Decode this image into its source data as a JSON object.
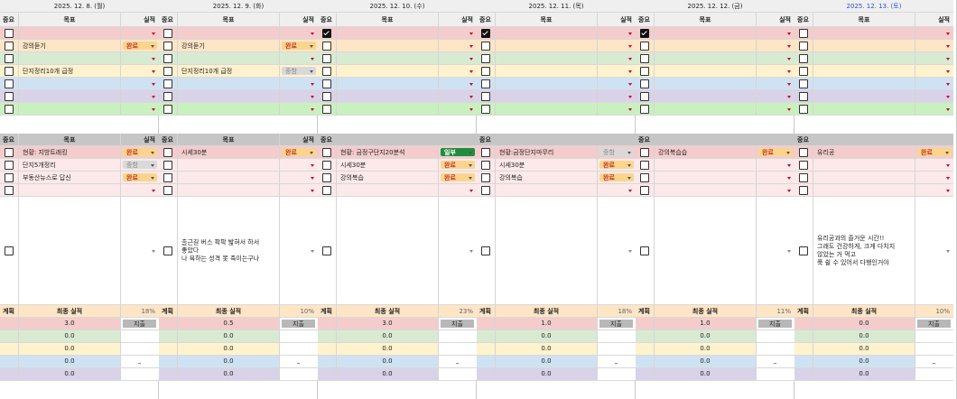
{
  "theme": {
    "top_colors": [
      "#f4cccc",
      "#fde5c6",
      "#d9ead3",
      "#fff2cc",
      "#cfe2f3",
      "#d9d2e9",
      "#c9f1c0"
    ],
    "bottom_colors": [
      "#f4cccc",
      "#fce9e9",
      "#fce9e9",
      "#fce9e9"
    ],
    "final_colors": [
      "#f4cccc",
      "#d9ead3",
      "#fff2cc",
      "#cfe2f3",
      "#d9d2e9"
    ],
    "sunday_date_color": "#2b4fd1"
  },
  "headers": {
    "priority": "중요",
    "goal": "목표",
    "result": "실적",
    "plan": "계획",
    "final": "최종 실적",
    "submit": "지출"
  },
  "days": [
    {
      "date": "2025. 12. 8. (월)",
      "top": [
        {
          "checked": false,
          "goal": "",
          "status": ""
        },
        {
          "checked": false,
          "goal": "강의듣기",
          "status": "완료"
        },
        {
          "checked": false,
          "goal": "",
          "status": ""
        },
        {
          "checked": false,
          "goal": "단지정리10개 급정",
          "status": ""
        },
        {
          "checked": false,
          "goal": "",
          "status": ""
        },
        {
          "checked": false,
          "goal": "",
          "status": ""
        },
        {
          "checked": false,
          "goal": "",
          "status": ""
        }
      ],
      "show_bottom_header": true,
      "bottom": [
        {
          "checked": false,
          "goal": "현황: 지방트래킹",
          "status": "완료"
        },
        {
          "checked": false,
          "goal": "단지5개정리",
          "status": "중함"
        },
        {
          "checked": false,
          "goal": "부동산뉴스로 답신",
          "status": "완료"
        },
        {
          "checked": false,
          "goal": "",
          "status": ""
        }
      ],
      "note": "",
      "pct": "18%",
      "final": [
        "3.0",
        "0.0",
        "0.0",
        "0.0",
        "0.0"
      ]
    },
    {
      "date": "2025. 12. 9. (화)",
      "top": [
        {
          "checked": false,
          "goal": "",
          "status": ""
        },
        {
          "checked": false,
          "goal": "강의듣기",
          "status": "완료"
        },
        {
          "checked": false,
          "goal": "",
          "status": ""
        },
        {
          "checked": false,
          "goal": "단지정리10개 급정",
          "status": "중함"
        },
        {
          "checked": false,
          "goal": "",
          "status": ""
        },
        {
          "checked": false,
          "goal": "",
          "status": ""
        },
        {
          "checked": false,
          "goal": "",
          "status": ""
        }
      ],
      "show_bottom_header": true,
      "bottom": [
        {
          "checked": false,
          "goal": "시세30분",
          "status": "완료"
        },
        {
          "checked": false,
          "goal": "",
          "status": ""
        },
        {
          "checked": false,
          "goal": "",
          "status": ""
        },
        {
          "checked": false,
          "goal": "",
          "status": ""
        }
      ],
      "note": "출근길 버스 팍팍 밟혀서 하서\n좋았다\n나 욕하는 성격 못 죽이는구나",
      "pct": "10%",
      "final": [
        "0.5",
        "0.0",
        "0.0",
        "0.0",
        "0.0"
      ]
    },
    {
      "date": "2025. 12. 10. (수)",
      "top": [
        {
          "checked": true,
          "goal": "",
          "status": ""
        },
        {
          "checked": false,
          "goal": "",
          "status": ""
        },
        {
          "checked": false,
          "goal": "",
          "status": ""
        },
        {
          "checked": false,
          "goal": "",
          "status": ""
        },
        {
          "checked": false,
          "goal": "",
          "status": ""
        },
        {
          "checked": false,
          "goal": "",
          "status": ""
        },
        {
          "checked": false,
          "goal": "",
          "status": ""
        }
      ],
      "show_bottom_header": false,
      "bottom": [
        {
          "checked": false,
          "goal": "현황: 금정구단지20분석",
          "status": "일부"
        },
        {
          "checked": false,
          "goal": "시세30분",
          "status": "완료"
        },
        {
          "checked": false,
          "goal": "강의복습",
          "status": "완료"
        },
        {
          "checked": false,
          "goal": "",
          "status": ""
        }
      ],
      "note": "",
      "pct": "23%",
      "final": [
        "3.0",
        "0.0",
        "0.0",
        "0.0",
        "0.0"
      ]
    },
    {
      "date": "2025. 12. 11. (목)",
      "top": [
        {
          "checked": true,
          "goal": "",
          "status": ""
        },
        {
          "checked": false,
          "goal": "",
          "status": ""
        },
        {
          "checked": false,
          "goal": "",
          "status": ""
        },
        {
          "checked": false,
          "goal": "",
          "status": ""
        },
        {
          "checked": false,
          "goal": "",
          "status": ""
        },
        {
          "checked": false,
          "goal": "",
          "status": ""
        },
        {
          "checked": false,
          "goal": "",
          "status": ""
        }
      ],
      "show_bottom_header": false,
      "bottom": [
        {
          "checked": false,
          "goal": "현황:금정단지마무리",
          "status": "중함"
        },
        {
          "checked": false,
          "goal": "시세30분",
          "status": "완료"
        },
        {
          "checked": false,
          "goal": "강의복습",
          "status": "완료"
        },
        {
          "checked": false,
          "goal": "",
          "status": ""
        }
      ],
      "note": "",
      "pct": "18%",
      "final": [
        "1.0",
        "0.0",
        "0.0",
        "0.0",
        "0.0"
      ]
    },
    {
      "date": "2025. 12. 12. (금)",
      "top": [
        {
          "checked": true,
          "goal": "",
          "status": ""
        },
        {
          "checked": false,
          "goal": "",
          "status": ""
        },
        {
          "checked": false,
          "goal": "",
          "status": ""
        },
        {
          "checked": false,
          "goal": "",
          "status": ""
        },
        {
          "checked": false,
          "goal": "",
          "status": ""
        },
        {
          "checked": false,
          "goal": "",
          "status": ""
        },
        {
          "checked": false,
          "goal": "",
          "status": ""
        }
      ],
      "show_bottom_header": false,
      "bottom": [
        {
          "checked": false,
          "goal": "강의복습습",
          "status": "완료"
        },
        {
          "checked": false,
          "goal": "",
          "status": ""
        },
        {
          "checked": false,
          "goal": "",
          "status": ""
        },
        {
          "checked": false,
          "goal": "",
          "status": ""
        }
      ],
      "note": "",
      "pct": "11%",
      "final": [
        "1.0",
        "0.0",
        "0.0",
        "0.0",
        "0.0"
      ]
    },
    {
      "date": "2025. 12. 13. (토)",
      "top": [
        {
          "checked": false,
          "goal": "",
          "status": ""
        },
        {
          "checked": false,
          "goal": "",
          "status": ""
        },
        {
          "checked": false,
          "goal": "",
          "status": ""
        },
        {
          "checked": false,
          "goal": "",
          "status": ""
        },
        {
          "checked": false,
          "goal": "",
          "status": ""
        },
        {
          "checked": false,
          "goal": "",
          "status": ""
        },
        {
          "checked": false,
          "goal": "",
          "status": ""
        }
      ],
      "show_bottom_header": false,
      "bottom": [
        {
          "checked": false,
          "goal": "유리공",
          "status": "완료"
        },
        {
          "checked": false,
          "goal": "",
          "status": ""
        },
        {
          "checked": false,
          "goal": "",
          "status": ""
        },
        {
          "checked": false,
          "goal": "",
          "status": ""
        }
      ],
      "note": "유리공과의 즐거운 시간!!\n그래도 건강하게, 크게 다치지\n않았는 거 먹고\n푹 쉴 수 있어서 다행인거야",
      "pct": "10%",
      "final": [
        "0.0",
        "0.0",
        "0.0",
        "0.0",
        "0.0"
      ]
    }
  ]
}
